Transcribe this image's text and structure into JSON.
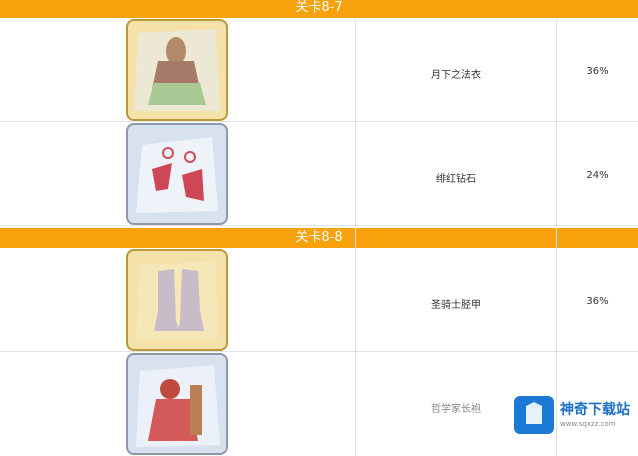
{
  "stages": [
    {
      "title": "关卡8-7",
      "items": [
        {
          "name": "月下之法衣",
          "rate": "36%",
          "icon": "robe-icon",
          "frame": "gold"
        },
        {
          "name": "绯红钻石",
          "rate": "24%",
          "icon": "earring-icon",
          "frame": "silver"
        }
      ]
    },
    {
      "title": "关卡8-8",
      "items": [
        {
          "name": "圣骑士胫甲",
          "rate": "36%",
          "icon": "boots-icon",
          "frame": "gold"
        },
        {
          "name": "哲学家长袍",
          "rate": "",
          "icon": "red-robe-icon",
          "frame": "silver"
        }
      ]
    }
  ],
  "watermark": {
    "title": "神奇下载站",
    "url": "www.sqxzz.com"
  },
  "colors": {
    "header": "#f7a10c",
    "gold_frame": "#b89a3a",
    "silver_frame": "#8d98ad",
    "watermark": "#1c7ad6"
  }
}
